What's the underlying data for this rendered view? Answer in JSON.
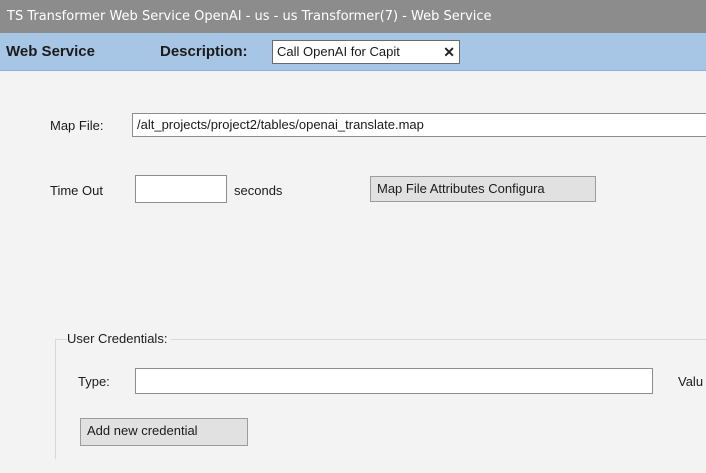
{
  "window": {
    "title": "TS Transformer Web Service OpenAI - us - us Transformer(7) - Web Service"
  },
  "header": {
    "section_label": "Web Service",
    "description_label": "Description:",
    "description_value": "Call OpenAI for Capit",
    "clear_icon": "close-icon"
  },
  "form": {
    "map_file_label": "Map File:",
    "map_file_value": "/alt_projects/project2/tables/openai_translate.map",
    "timeout_label": "Time Out",
    "timeout_value": "",
    "timeout_units": "seconds",
    "map_attr_button": "Map File Attributes Configura"
  },
  "credentials": {
    "group_label": "User Credentials:",
    "type_label": "Type:",
    "type_value": "",
    "value_label": "Valu",
    "add_button": "Add new credential"
  }
}
